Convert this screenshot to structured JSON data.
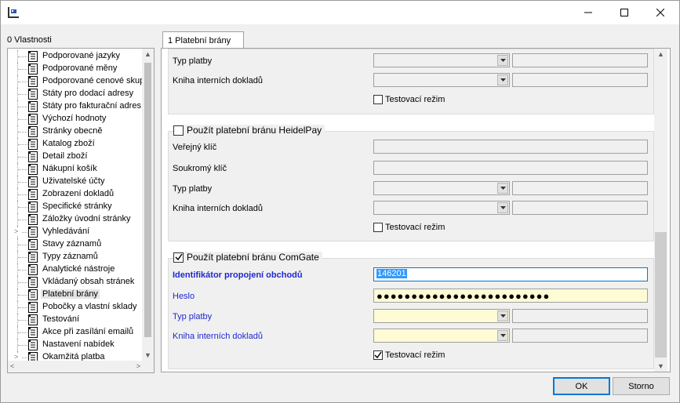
{
  "titlebar": {
    "app_icon": "app-icon",
    "minimize": "minimize-icon",
    "maximize": "maximize-icon",
    "close": "close-icon"
  },
  "left": {
    "title": "0 Vlastnosti",
    "items": [
      {
        "label": "Podporované jazyky",
        "expandable": false
      },
      {
        "label": "Podporované měny",
        "expandable": false
      },
      {
        "label": "Podporované cenové skup",
        "expandable": false
      },
      {
        "label": "Státy pro dodací adresy",
        "expandable": false
      },
      {
        "label": "Státy pro fakturační adres",
        "expandable": false
      },
      {
        "label": "Výchozí hodnoty",
        "expandable": false
      },
      {
        "label": "Stránky obecně",
        "expandable": false
      },
      {
        "label": "Katalog zboží",
        "expandable": false
      },
      {
        "label": "Detail zboží",
        "expandable": false
      },
      {
        "label": "Nákupní košík",
        "expandable": false
      },
      {
        "label": "Uživatelské účty",
        "expandable": false
      },
      {
        "label": "Zobrazení dokladů",
        "expandable": false
      },
      {
        "label": "Specifické stránky",
        "expandable": false
      },
      {
        "label": "Záložky úvodní stránky",
        "expandable": false
      },
      {
        "label": "Vyhledávání",
        "expandable": true
      },
      {
        "label": "Stavy záznamů",
        "expandable": false
      },
      {
        "label": "Typy záznamů",
        "expandable": false
      },
      {
        "label": "Analytické nástroje",
        "expandable": false
      },
      {
        "label": "Vkládaný obsah stránek",
        "expandable": false
      },
      {
        "label": "Platební brány",
        "expandable": false,
        "selected": true
      },
      {
        "label": "Pobočky a vlastní sklady",
        "expandable": false
      },
      {
        "label": "Testování",
        "expandable": false
      },
      {
        "label": "Akce při zasílání emailů",
        "expandable": false
      },
      {
        "label": "Nastavení nabídek",
        "expandable": false
      },
      {
        "label": "Okamžitá platba",
        "expandable": true
      }
    ]
  },
  "tab": {
    "label": "1 Platební brány"
  },
  "section1": {
    "typ_platby": "Typ platby",
    "kniha": "Kniha interních dokladů",
    "testovaci": "Testovací režim"
  },
  "heidelpay": {
    "legend": "Použít platební bránu HeidelPay",
    "verejny": "Veřejný klíč",
    "soukromy": "Soukromý klíč",
    "typ_platby": "Typ platby",
    "kniha": "Kniha interních dokladů",
    "testovaci": "Testovací režim"
  },
  "comgate": {
    "legend": "Použít platební bránu ComGate",
    "ident_label": "Identifikátor propojení obchodů",
    "ident_value": "146201",
    "heslo_label": "Heslo",
    "heslo_value": "●●●●●●●●●●●●●●●●●●●●●●●●●",
    "typ_platby": "Typ platby",
    "kniha": "Kniha interních dokladů",
    "testovaci": "Testovací režim"
  },
  "buttons": {
    "ok": "OK",
    "cancel": "Storno"
  },
  "colors": {
    "required_label": "#1f28d0",
    "selection": "#3399ff",
    "yellow_field": "#fffbd5"
  }
}
